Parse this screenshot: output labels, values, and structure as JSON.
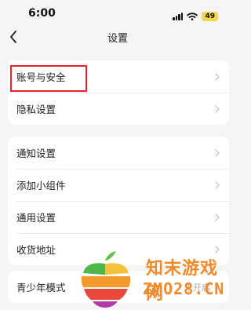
{
  "status_bar": {
    "time": "6:00",
    "battery": "49",
    "icons": [
      "signal-icon",
      "wifi-icon",
      "battery-icon"
    ],
    "battery_color": "#f3d64a"
  },
  "nav": {
    "title": "设置",
    "back_icon": "chevron-left-icon"
  },
  "groups": [
    {
      "items": [
        {
          "label": "账号与安全"
        },
        {
          "label": "隐私设置"
        }
      ]
    },
    {
      "items": [
        {
          "label": "通知设置"
        },
        {
          "label": "添加小组件"
        },
        {
          "label": "通用设置"
        },
        {
          "label": "收货地址"
        }
      ]
    },
    {
      "items": [
        {
          "label": "青少年模式",
          "value": "未开启"
        }
      ]
    }
  ],
  "highlight_color": "#e0262a",
  "watermark": {
    "line1": "知末游戏网",
    "line2": "ZMO28.CN",
    "color": "#f08a2a"
  }
}
